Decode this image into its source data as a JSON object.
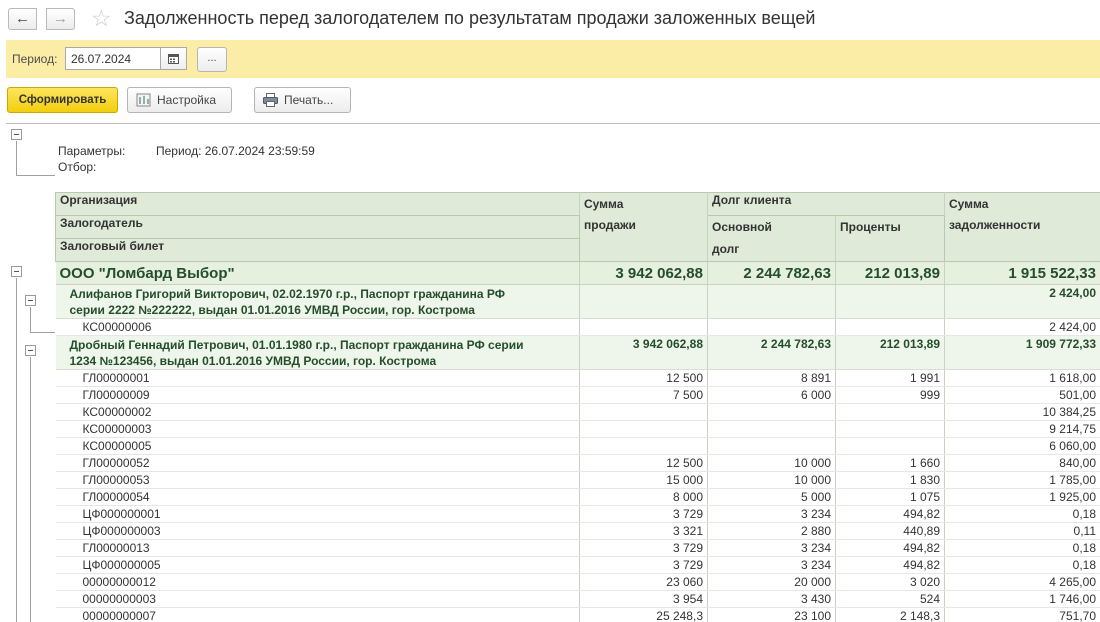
{
  "window": {
    "title": "Задолженность перед залогодателем по результатам продажи заложенных вещей",
    "back_icon": "←",
    "forward_icon": "→",
    "star_icon": "☆"
  },
  "period_bar": {
    "label": "Период:",
    "date_value": "26.07.2024",
    "dots_label": "..."
  },
  "commands": {
    "generate": "Сформировать",
    "settings": "Настройка",
    "print": "Печать..."
  },
  "report": {
    "params_label": "Параметры:",
    "params_value": "Период: 26.07.2024 23:59:59",
    "filter_label": "Отбор:",
    "header": {
      "org": "Организация",
      "pledger": "Залогодатель",
      "ticket": "Залоговый билет",
      "sale_sum": [
        "Сумма",
        "продажи"
      ],
      "client_debt": "Долг клиента",
      "main_debt": [
        "Основной",
        "долг"
      ],
      "interest": "Проценты",
      "debt_sum": [
        "Сумма",
        "задолженности"
      ]
    },
    "org_row": {
      "name": "ООО \"Ломбард Выбор\"",
      "sale": "3 942 062,88",
      "main": "2 244 782,63",
      "interest": "212 013,89",
      "debt": "1 915 522,33"
    },
    "pledger1": {
      "name": [
        "Алифанов Григорий Викторович, 02.02.1970 г.р., Паспорт гражданина РФ",
        "серии 2222 №222222, выдан 01.01.2016 УМВД России, гор. Кострома"
      ],
      "sale": "",
      "main": "",
      "interest": "",
      "debt": "2 424,00"
    },
    "pledger1_items": [
      {
        "ticket": "КС00000006",
        "sale": "",
        "main": "",
        "interest": "",
        "debt": "2 424,00"
      }
    ],
    "pledger2": {
      "name": [
        "Дробный Геннадий Петрович, 01.01.1980 г.р., Паспорт гражданина РФ серии",
        "1234 №123456, выдан 01.01.2016 УМВД России, гор. Кострома"
      ],
      "sale": "3 942 062,88",
      "main": "2 244 782,63",
      "interest": "212 013,89",
      "debt": "1 909 772,33"
    },
    "pledger2_items": [
      {
        "ticket": "ГЛ00000001",
        "sale": "12 500",
        "main": "8 891",
        "interest": "1 991",
        "debt": "1 618,00"
      },
      {
        "ticket": "ГЛ00000009",
        "sale": "7 500",
        "main": "6 000",
        "interest": "999",
        "debt": "501,00"
      },
      {
        "ticket": "КС00000002",
        "sale": "",
        "main": "",
        "interest": "",
        "debt": "10 384,25"
      },
      {
        "ticket": "КС00000003",
        "sale": "",
        "main": "",
        "interest": "",
        "debt": "9 214,75"
      },
      {
        "ticket": "КС00000005",
        "sale": "",
        "main": "",
        "interest": "",
        "debt": "6 060,00"
      },
      {
        "ticket": "ГЛ00000052",
        "sale": "12 500",
        "main": "10 000",
        "interest": "1 660",
        "debt": "840,00"
      },
      {
        "ticket": "ГЛ00000053",
        "sale": "15 000",
        "main": "10 000",
        "interest": "1 830",
        "debt": "1 785,00"
      },
      {
        "ticket": "ГЛ00000054",
        "sale": "8 000",
        "main": "5 000",
        "interest": "1 075",
        "debt": "1 925,00"
      },
      {
        "ticket": "ЦФ000000001",
        "sale": "3 729",
        "main": "3 234",
        "interest": "494,82",
        "debt": "0,18"
      },
      {
        "ticket": "ЦФ000000003",
        "sale": "3 321",
        "main": "2 880",
        "interest": "440,89",
        "debt": "0,11"
      },
      {
        "ticket": "ГЛ00000013",
        "sale": "3 729",
        "main": "3 234",
        "interest": "494,82",
        "debt": "0,18"
      },
      {
        "ticket": "ЦФ000000005",
        "sale": "3 729",
        "main": "3 234",
        "interest": "494,82",
        "debt": "0,18"
      },
      {
        "ticket": "00000000012",
        "sale": "23 060",
        "main": "20 000",
        "interest": "3 020",
        "debt": "4 265,00"
      },
      {
        "ticket": "00000000003",
        "sale": "3 954",
        "main": "3 430",
        "interest": "524",
        "debt": "1 746,00"
      },
      {
        "ticket": "00000000007",
        "sale": "25 248,3",
        "main": "23 100",
        "interest": "2 148,3",
        "debt": "751,70"
      }
    ]
  }
}
